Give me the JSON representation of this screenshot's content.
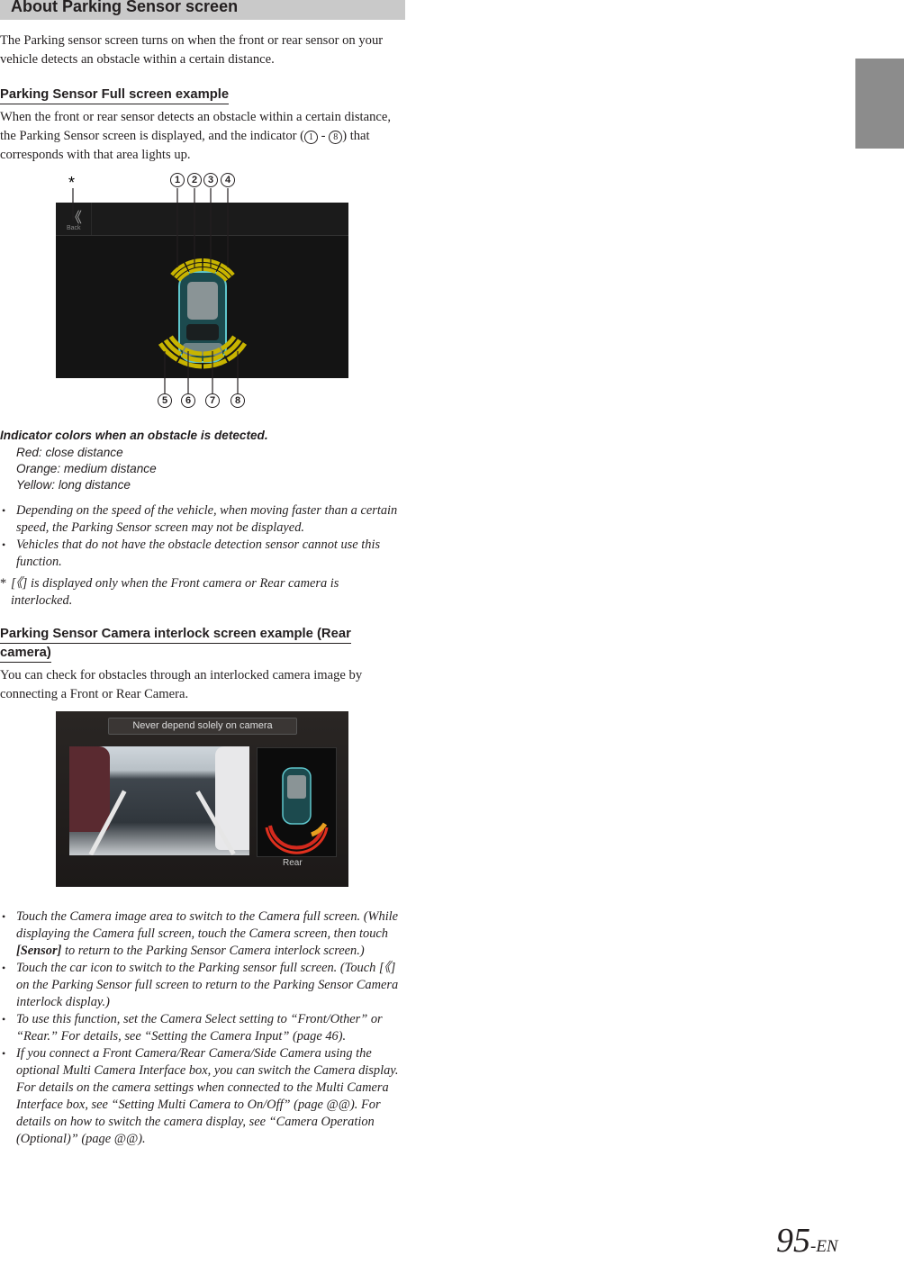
{
  "header": {
    "title": "About Parking Sensor screen"
  },
  "intro": "The Parking sensor screen turns on when the front or rear sensor on your vehicle detects an obstacle within a certain distance.",
  "section1": {
    "title": "Parking Sensor Full screen example",
    "text": "When the front or rear sensor detects an obstacle within a certain distance, the Parking Sensor screen is displayed, and the indicator (",
    "text_range_start": "1",
    "text_dash": " - ",
    "text_range_end": "8",
    "text_end": ") that corresponds with that area lights up.",
    "figure": {
      "asterisk": "*",
      "back_label": "Back",
      "front_indicators": [
        "1",
        "2",
        "3",
        "4"
      ],
      "rear_indicators": [
        "5",
        "6",
        "7",
        "8"
      ],
      "indicator_color": "#c8b400"
    },
    "colors_heading": "Indicator colors when an obstacle is detected.",
    "colors": [
      "Red: close distance",
      "Orange: medium distance",
      "Yellow: long distance"
    ],
    "notes": [
      "Depending on the speed of the vehicle, when moving faster than a certain speed, the Parking Sensor screen may not be displayed.",
      "Vehicles that do not have the obstacle detection sensor cannot use this function."
    ],
    "footnote_mark": "*",
    "footnote": "[《] is displayed only when the Front camera or Rear camera is interlocked."
  },
  "section2": {
    "title_line1": "Parking Sensor Camera interlock screen example (Rear ",
    "title_line2": "camera)",
    "text": "You can check for obstacles through an interlocked camera image by connecting a Front or Rear Camera.",
    "figure": {
      "banner": "Never depend solely on camera",
      "label": "Rear"
    },
    "notes": [
      {
        "a": "Touch the Camera image area to switch to the Camera full screen. (While displaying the Camera full screen, touch the Camera screen, then touch ",
        "b": "[Sensor]",
        "c": " to return to the Parking Sensor Camera interlock screen.)"
      },
      {
        "a": "Touch the car icon to switch to the Parking sensor full screen. (Touch [《] on the Parking Sensor full screen to return to the Parking Sensor Camera interlock display.)"
      },
      {
        "a": "To use this function, set the Camera Select setting to “Front/Other” or “Rear.” For details, see “Setting the Camera Input” (page 46)."
      },
      {
        "a": "If you connect a Front Camera/Rear Camera/Side Camera using the optional Multi Camera Interface box, you can switch the Camera display. For details on the camera settings when connected to the Multi Camera Interface box, see “Setting Multi Camera to On/Off” (page @@). For details on how to switch the camera display, see “Camera Operation (Optional)” (page @@)."
      }
    ]
  },
  "page": {
    "number": "95",
    "suffix": "-EN"
  }
}
